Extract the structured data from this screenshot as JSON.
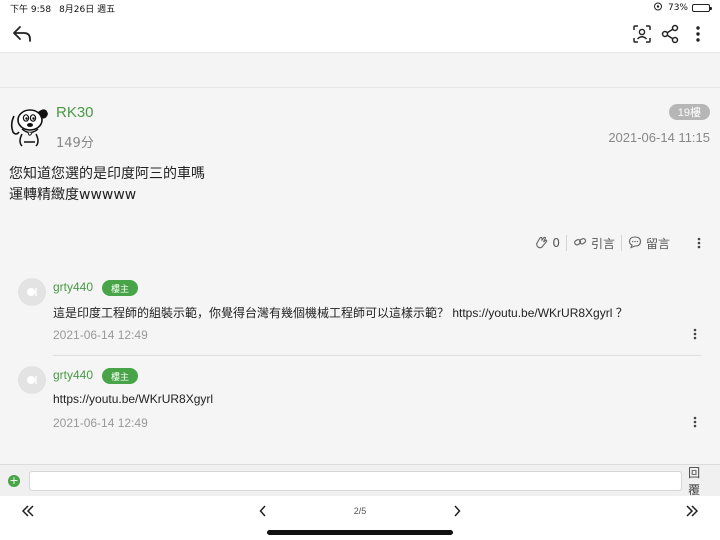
{
  "status_bar": {
    "time": "下午 9:58",
    "date": "8月26日 週五",
    "battery": "73%",
    "battery_level": 0.73
  },
  "toolbar": {
    "back_icon": "reply-back-icon",
    "scan_icon": "scan-user-icon",
    "share_icon": "share-icon",
    "more_icon": "more-vertical-icon"
  },
  "post": {
    "author": "RK30",
    "score": "149分",
    "floor": "19樓",
    "time": "2021-06-14 11:15",
    "content_lines": [
      "您知道您選的是印度阿三的車嗎",
      "運轉精緻度wwwww"
    ],
    "actions": {
      "like_count": "0",
      "quote_label": "引言",
      "comment_label": "留言"
    }
  },
  "comments": [
    {
      "name": "grty440",
      "badge": "樓主",
      "text": "這是印度工程師的組裝示範，你覺得台灣有幾個機械工程師可以這樣示範？ https://youtu.be/WKrUR8Xgyrl ？",
      "time": "2021-06-14 12:49"
    },
    {
      "name": "grty440",
      "badge": "樓主",
      "text": "https://youtu.be/WKrUR8Xgyrl",
      "time": "2021-06-14 12:49"
    }
  ],
  "reply_bar": {
    "input_value": "",
    "send_label": "回覆"
  },
  "pager": {
    "page_info": "2/5"
  },
  "colors": {
    "accent_green": "#4a9a45",
    "badge_green": "#47a447",
    "floor_badge_gray": "#b6b6b6"
  }
}
